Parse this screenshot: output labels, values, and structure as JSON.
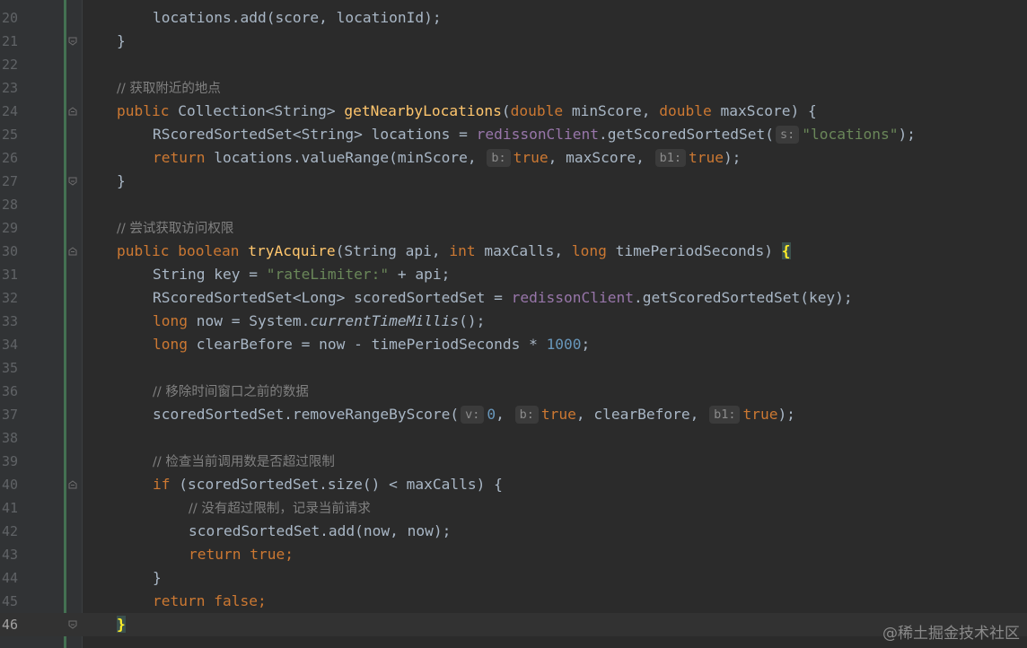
{
  "gutter": {
    "line_numbers": [
      "20",
      "21",
      "22",
      "23",
      "24",
      "25",
      "26",
      "27",
      "28",
      "29",
      "30",
      "31",
      "32",
      "33",
      "34",
      "35",
      "36",
      "37",
      "38",
      "39",
      "40",
      "41",
      "42",
      "43",
      "44",
      "45",
      "46"
    ]
  },
  "code": {
    "l20_a": "locations.add(score, locationId);",
    "l21_a": "}",
    "l23_a": "// 获取附近的地点",
    "l24_kw1": "public",
    "l24_t1": " Collection<String> ",
    "l24_fn": "getNearbyLocations",
    "l24_t2": "(",
    "l24_kw2": "double",
    "l24_t3": " minScore, ",
    "l24_kw3": "double",
    "l24_t4": " maxScore) {",
    "l25_t1": "RScoredSortedSet<String> locations = ",
    "l25_field": "redissonClient",
    "l25_t2": ".getScoredSortedSet(",
    "l25_hint": "s:",
    "l25_str": "\"locations\"",
    "l25_t3": ");",
    "l26_kw": "return",
    "l26_t1": " locations.valueRange(minScore, ",
    "l26_hint1": "b:",
    "l26_kw2": "true",
    "l26_t2": ", maxScore, ",
    "l26_hint2": "b1:",
    "l26_kw3": "true",
    "l26_t3": ");",
    "l27_a": "}",
    "l29_a": "// 尝试获取访问权限",
    "l30_kw1": "public",
    "l30_kw2": "boolean",
    "l30_fn": "tryAcquire",
    "l30_t1": "(String api, ",
    "l30_kw3": "int",
    "l30_t2": " maxCalls, ",
    "l30_kw4": "long",
    "l30_t3": " timePeriodSeconds) ",
    "l30_brace": "{",
    "l31_t1": "String key = ",
    "l31_str": "\"rateLimiter:\"",
    "l31_t2": " + api;",
    "l32_t1": "RScoredSortedSet<Long> scoredSortedSet = ",
    "l32_field": "redissonClient",
    "l32_t2": ".getScoredSortedSet(key);",
    "l33_kw": "long",
    "l33_t1": " now = System.",
    "l33_ital": "currentTimeMillis",
    "l33_t2": "();",
    "l34_kw": "long",
    "l34_t1": " clearBefore = now - timePeriodSeconds * ",
    "l34_num": "1000",
    "l34_t2": ";",
    "l36_a": "// 移除时间窗口之前的数据",
    "l37_t1": "scoredSortedSet.removeRangeByScore(",
    "l37_hint1": "v:",
    "l37_num": "0",
    "l37_t2": ", ",
    "l37_hint2": "b:",
    "l37_kw1": "true",
    "l37_t3": ", clearBefore, ",
    "l37_hint3": "b1:",
    "l37_kw2": "true",
    "l37_t4": ");",
    "l39_a": "// 检查当前调用数是否超过限制",
    "l40_kw": "if",
    "l40_t1": " (scoredSortedSet.size() < maxCalls) {",
    "l41_a": "// 没有超过限制，记录当前请求",
    "l42_a": "scoredSortedSet.add(now, now);",
    "l43_kw1": "return",
    "l43_kw2": "true",
    "l43_t1": ";",
    "l44_a": "}",
    "l45_kw1": "return",
    "l45_kw2": "false",
    "l45_t1": ";",
    "l46_brace": "}"
  },
  "watermark": "@稀土掘金技术社区",
  "colors": {
    "background": "#2b2b2b",
    "gutter": "#313335",
    "keyword": "#cc7832",
    "function": "#ffc66d",
    "string": "#6a8759",
    "number": "#6897bb",
    "comment": "#808080",
    "field": "#9876aa",
    "text": "#a9b7c6",
    "change_bar": "#447152"
  }
}
